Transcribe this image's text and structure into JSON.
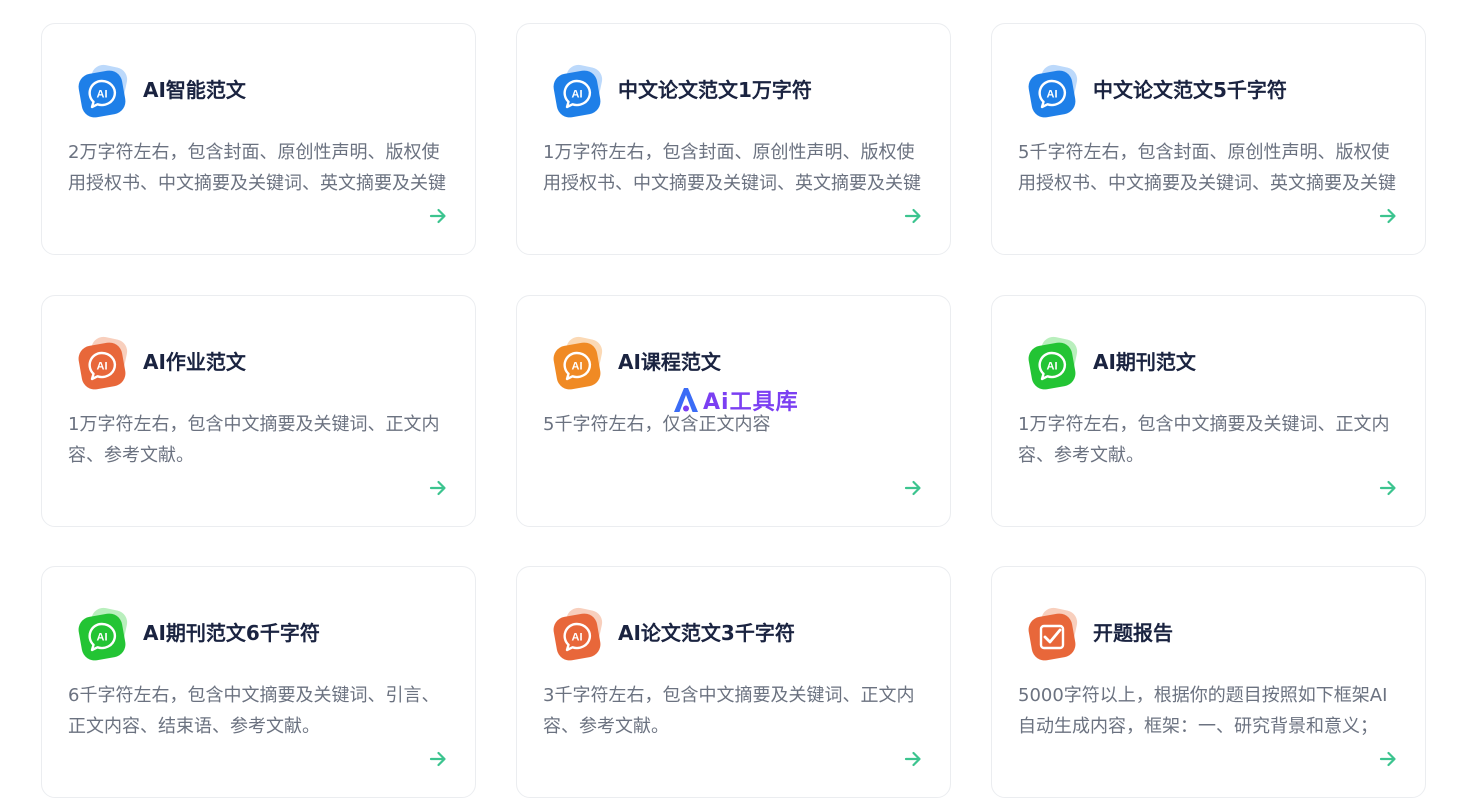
{
  "colors": {
    "blue": "#1e7fe8",
    "blue_light": "#bcd9fb",
    "orange_red": "#e8673a",
    "orange_red_light": "#f8cfbd",
    "orange": "#f08a24",
    "orange_light": "#fbd9b5",
    "green": "#23c434",
    "green_light": "#b9efbd",
    "arrow": "#3cc48f",
    "watermark": "#7b3ff2"
  },
  "icon_label": "AI",
  "watermark_text": "Ai工具库",
  "cards": [
    {
      "title": "AI智能范文",
      "desc": "2万字符左右，包含封面、原创性声明、版权使用授权书、中文摘要及关键词、英文摘要及关键",
      "icon": "ai-badge-icon",
      "theme": "blue"
    },
    {
      "title": "中文论文范文1万字符",
      "desc": "1万字符左右，包含封面、原创性声明、版权使用授权书、中文摘要及关键词、英文摘要及关键",
      "icon": "ai-badge-icon",
      "theme": "blue"
    },
    {
      "title": "中文论文范文5千字符",
      "desc": "5千字符左右，包含封面、原创性声明、版权使用授权书、中文摘要及关键词、英文摘要及关键",
      "icon": "ai-badge-icon",
      "theme": "blue"
    },
    {
      "title": "AI作业范文",
      "desc": "1万字符左右，包含中文摘要及关键词、正文内容、参考文献。",
      "icon": "ai-badge-icon",
      "theme": "orange_red"
    },
    {
      "title": "AI课程范文",
      "desc": "5千字符左右，仅含正文内容",
      "icon": "ai-badge-icon",
      "theme": "orange"
    },
    {
      "title": "AI期刊范文",
      "desc": "1万字符左右，包含中文摘要及关键词、正文内容、参考文献。",
      "icon": "ai-badge-icon",
      "theme": "green"
    },
    {
      "title": "AI期刊范文6千字符",
      "desc": "6千字符左右，包含中文摘要及关键词、引言、正文内容、结束语、参考文献。",
      "icon": "ai-badge-icon",
      "theme": "green"
    },
    {
      "title": "AI论文范文3千字符",
      "desc": "3千字符左右，包含中文摘要及关键词、正文内容、参考文献。",
      "icon": "ai-badge-icon",
      "theme": "orange_red"
    },
    {
      "title": "开题报告",
      "desc": "5000字符以上，根据你的题目按照如下框架AI自动生成内容，框架：一、研究背景和意义；",
      "icon": "checklist-icon",
      "theme": "orange_red"
    }
  ]
}
